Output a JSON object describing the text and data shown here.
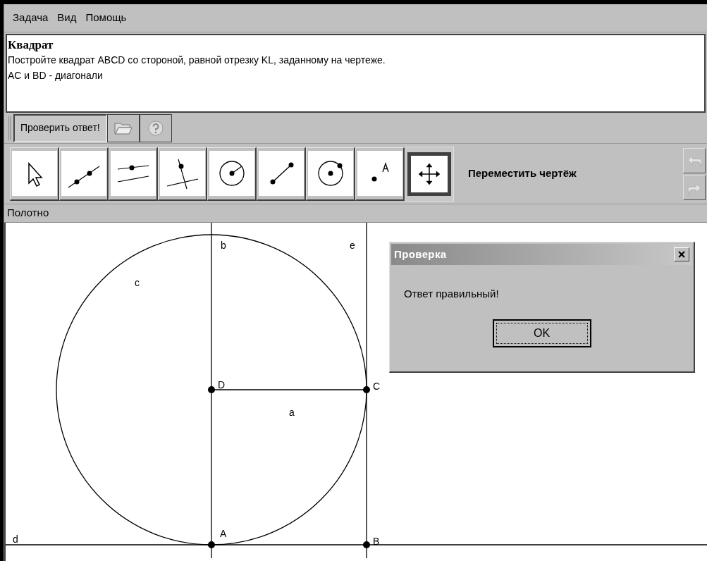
{
  "menu": [
    {
      "label": "Задача"
    },
    {
      "label": "Вид"
    },
    {
      "label": "Помощь"
    }
  ],
  "task": {
    "title": "Квадрат",
    "lines": [
      "Постройте квадрат ABCD со стороной, равной отрезку KL, заданному на чертеже.",
      "AC и BD - диагонали"
    ]
  },
  "action_bar": {
    "check_button": "Проверить ответ!"
  },
  "tools": [
    {
      "kind": "pointer",
      "selected": false
    },
    {
      "kind": "line",
      "selected": false
    },
    {
      "kind": "parallel",
      "selected": false
    },
    {
      "kind": "perpendicular",
      "selected": false
    },
    {
      "kind": "circle",
      "selected": false
    },
    {
      "kind": "segment",
      "selected": false
    },
    {
      "kind": "circle-point",
      "selected": false
    },
    {
      "kind": "point",
      "selected": false
    },
    {
      "kind": "move",
      "selected": true
    }
  ],
  "tool_name": "Переместить чертёж",
  "history": {
    "undo_disabled": true,
    "redo_disabled": true
  },
  "panel_label": "Полотно",
  "canvas": {
    "objects": [
      {
        "kind": "circle",
        "label": "c"
      },
      {
        "kind": "line",
        "label": "b"
      },
      {
        "kind": "line",
        "label": "e"
      },
      {
        "kind": "line",
        "label": "d"
      },
      {
        "kind": "segment",
        "label": "a"
      },
      {
        "kind": "point",
        "label": "D"
      },
      {
        "kind": "point",
        "label": "C"
      },
      {
        "kind": "point",
        "label": "A"
      },
      {
        "kind": "point",
        "label": "B"
      }
    ]
  },
  "dialog": {
    "title": "Проверка",
    "message": "Ответ правильный!",
    "ok_button": "OK"
  }
}
